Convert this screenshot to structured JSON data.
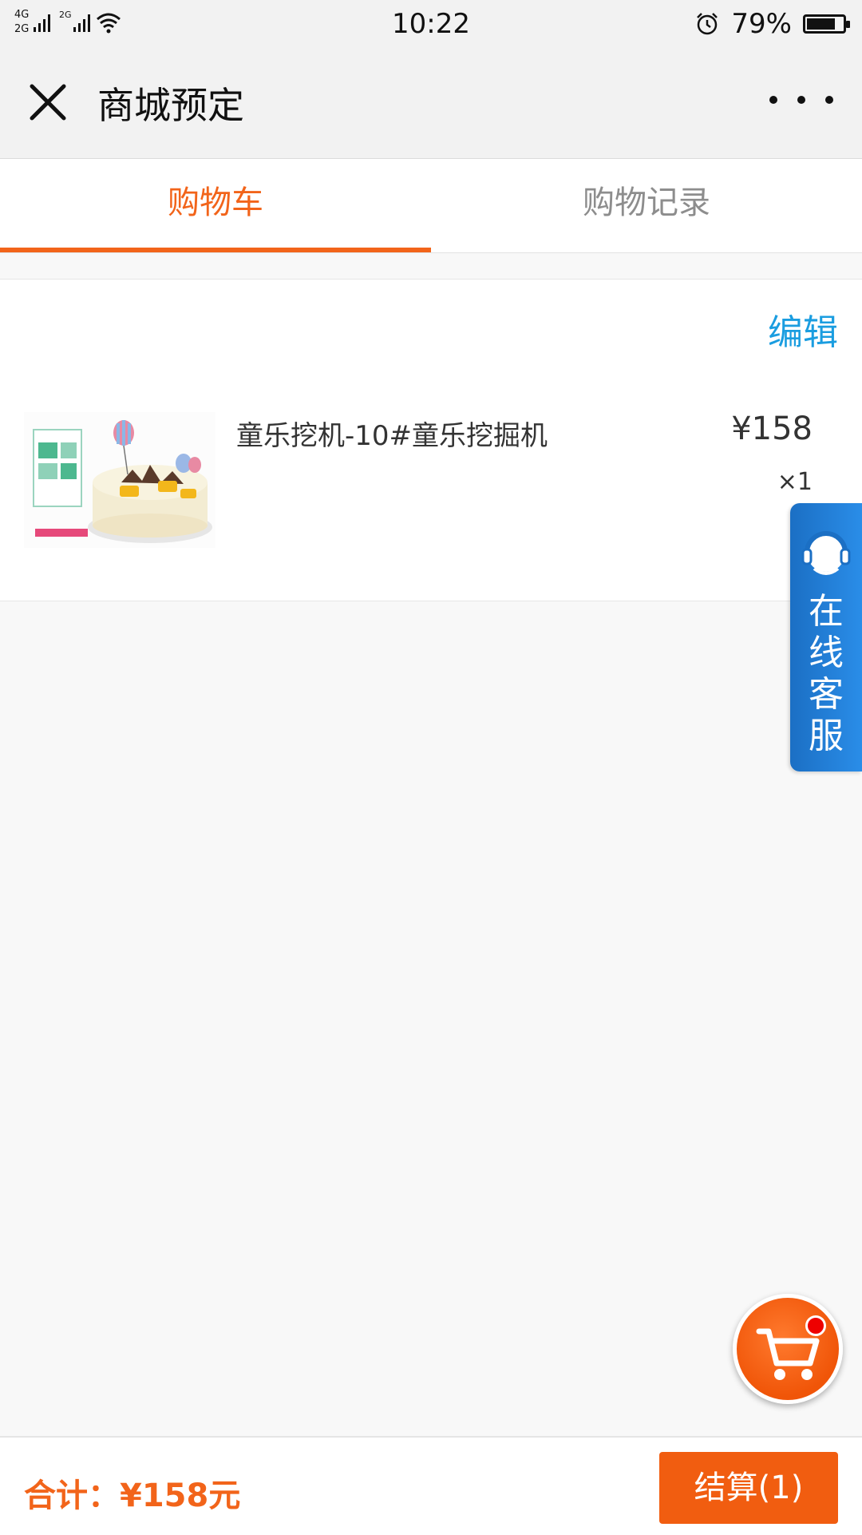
{
  "status_bar": {
    "network_1": "4G",
    "network_2": "2G",
    "network_3": "2G",
    "time": "10:22",
    "battery_percent": "79%",
    "battery_level": 0.79
  },
  "header": {
    "title": "商城预定"
  },
  "tabs": [
    {
      "label": "购物车",
      "active": true
    },
    {
      "label": "购物记录",
      "active": false
    }
  ],
  "cart": {
    "edit_label": "编辑",
    "items": [
      {
        "name": "童乐挖机-10#童乐挖掘机",
        "price": "¥158",
        "quantity": "×1"
      }
    ]
  },
  "service": {
    "label": "在线客服"
  },
  "footer": {
    "total_label": "合计：",
    "total_value": "¥158元",
    "checkout_label": "结算(1)"
  },
  "colors": {
    "accent": "#f2641a",
    "link": "#1a9de0",
    "service": "#1b6fc4"
  }
}
